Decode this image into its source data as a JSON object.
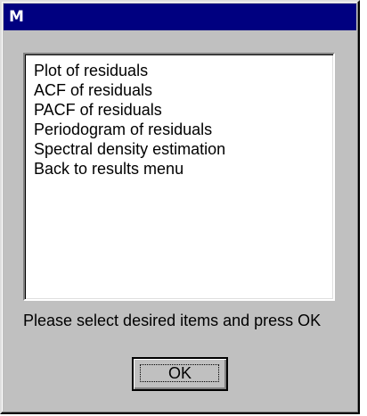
{
  "window": {
    "title": "M"
  },
  "listbox": {
    "items": [
      {
        "label": "Plot of residuals"
      },
      {
        "label": "ACF of residuals"
      },
      {
        "label": "PACF of residuals"
      },
      {
        "label": "Periodogram of residuals"
      },
      {
        "label": "Spectral density estimation"
      },
      {
        "label": "Back to results menu"
      }
    ]
  },
  "status": {
    "text": "Please select desired items and press OK"
  },
  "buttons": {
    "ok_label": "OK"
  },
  "colors": {
    "titlebar": "#000080",
    "face": "#c0c0c0",
    "list_background": "#ffffff"
  }
}
